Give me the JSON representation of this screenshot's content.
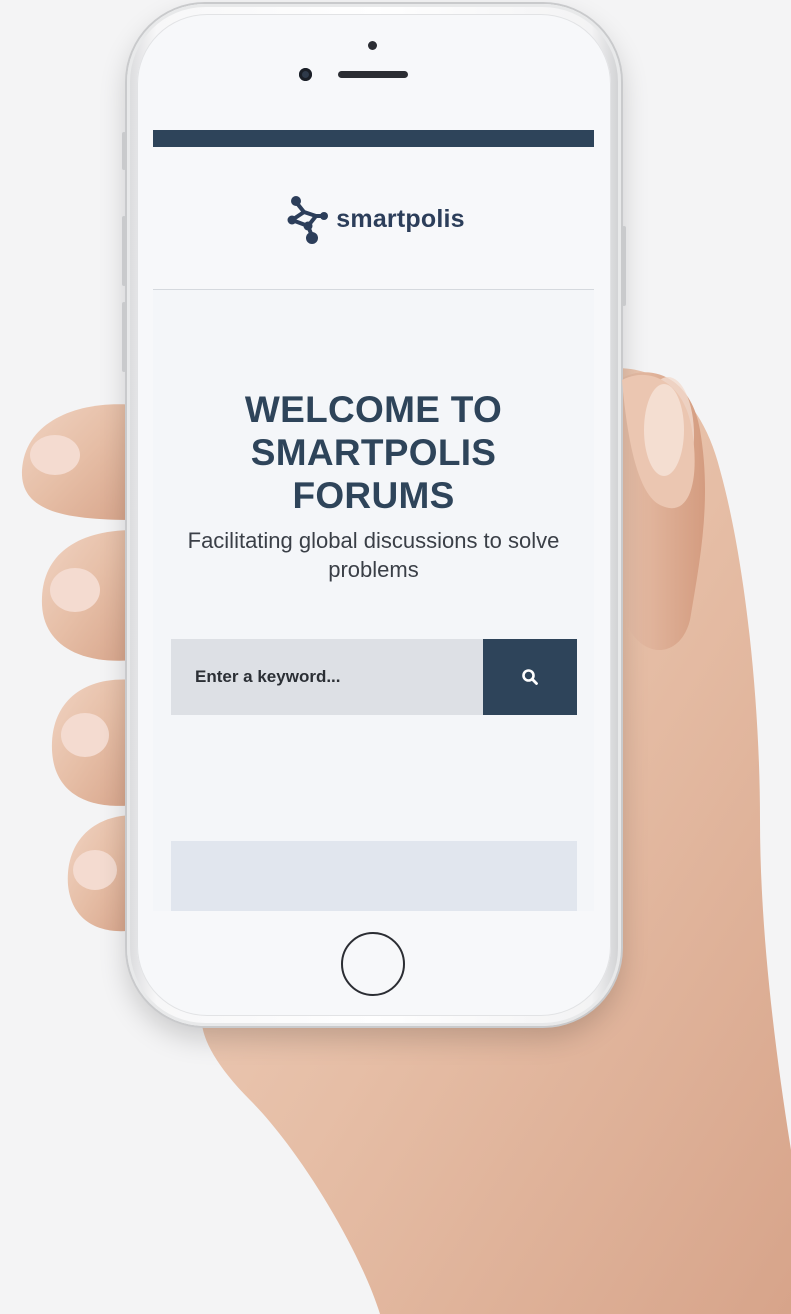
{
  "brand": {
    "name": "smartpolis",
    "logo_icon": "network-nodes-icon",
    "colors": {
      "primary": "#2e445a",
      "logo": "#2c3e5a",
      "input_bg": "#dde0e5",
      "card_bg": "#e1e6ee"
    }
  },
  "hero": {
    "title": "WELCOME TO SMARTPOLIS FORUMS",
    "subtitle": "Facilitating global discussions to solve problems"
  },
  "search": {
    "placeholder": "Enter a keyword...",
    "button_icon": "search-icon"
  }
}
